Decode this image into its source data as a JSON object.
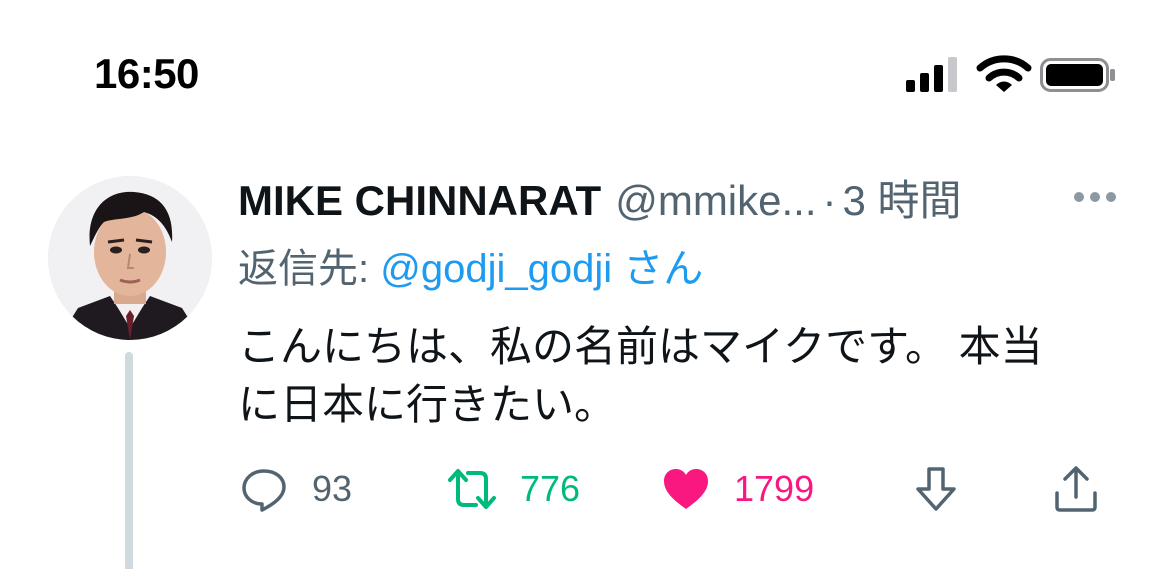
{
  "status_bar": {
    "time": "16:50"
  },
  "tweet": {
    "author_name": "MIKE CHINNARAT",
    "author_handle": "@mmike...",
    "separator": "·",
    "time_ago": "3 時間",
    "reply_prefix": "返信先: ",
    "reply_handle": "@godji_godji",
    "reply_suffix": " さん",
    "text": "こんにちは、私の名前はマイクです。 本当\nに日本に行きたい。",
    "actions": {
      "reply_count": "93",
      "retweet_count": "776",
      "like_count": "1799"
    }
  },
  "colors": {
    "accent_blue": "#1d9bf0",
    "retweet_green": "#00ba7c",
    "like_pink": "#f91880",
    "muted_gray": "#536471"
  },
  "icons": [
    "signal-icon",
    "wifi-icon",
    "battery-icon",
    "more-icon",
    "reply-icon",
    "retweet-icon",
    "like-icon",
    "download-icon",
    "share-icon"
  ]
}
